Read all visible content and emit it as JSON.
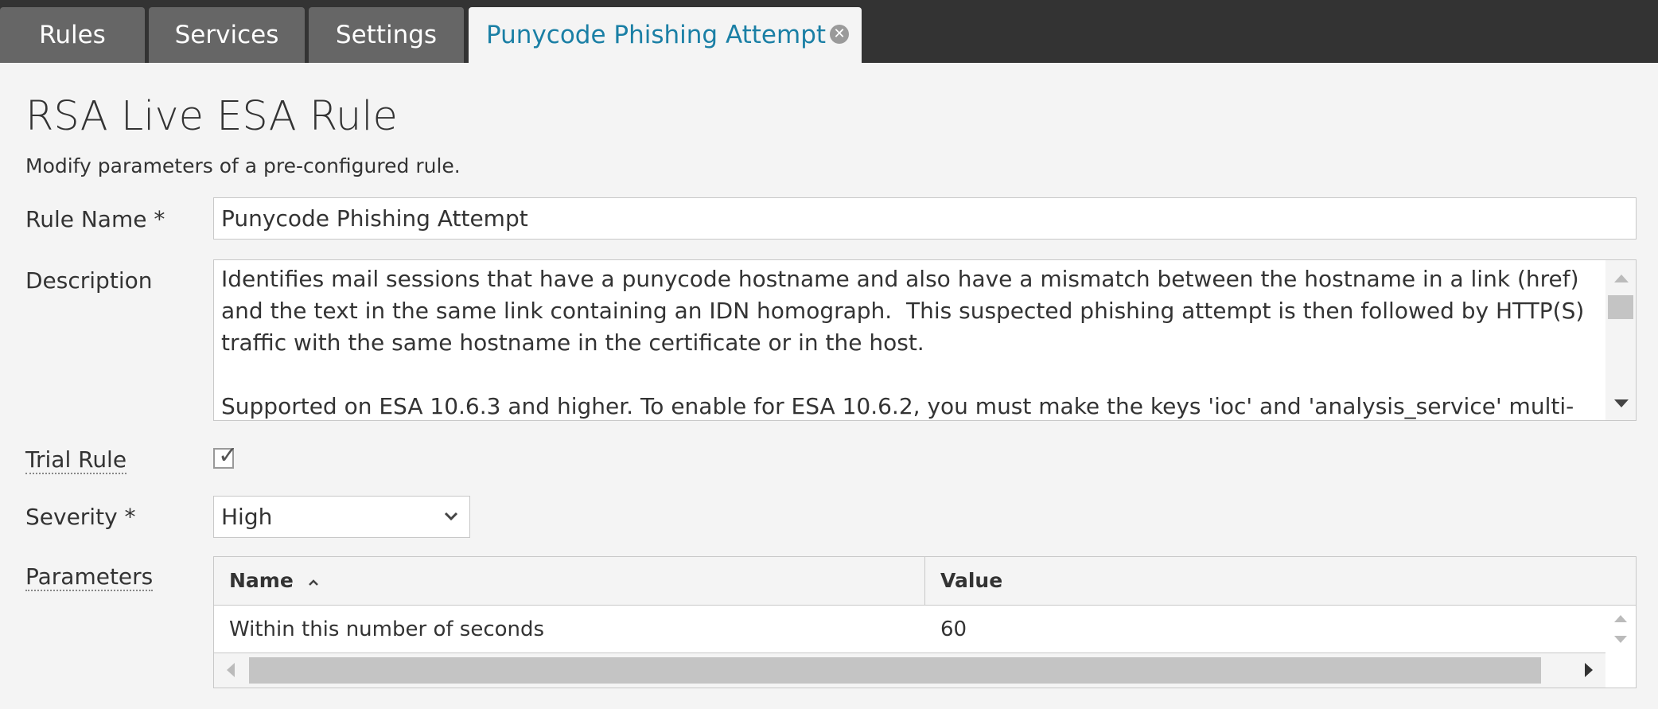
{
  "tabs": [
    {
      "label": "Rules"
    },
    {
      "label": "Services"
    },
    {
      "label": "Settings"
    },
    {
      "label": "Punycode Phishing Attempt",
      "active": true
    }
  ],
  "page": {
    "title": "RSA Live ESA Rule",
    "subtitle": "Modify parameters of a pre-configured rule."
  },
  "form": {
    "rule_name_label": "Rule Name *",
    "rule_name_value": "Punycode Phishing Attempt",
    "description_label": "Description",
    "description_value": "Identifies mail sessions that have a punycode hostname and also have a mismatch between the hostname in a link (href) and the text in the same link containing an IDN homograph.  This suspected phishing attempt is then followed by HTTP(S) traffic with the same hostname in the certificate or in the host.\n\nSupported on ESA 10.6.3 and higher. To enable for ESA 10.6.2, you must make the keys 'ioc' and 'analysis_service' multi-valued",
    "trial_rule_label": "Trial Rule",
    "trial_rule_checked": true,
    "severity_label": "Severity *",
    "severity_value": "High",
    "parameters_label": "Parameters"
  },
  "parameters_table": {
    "columns": [
      "Name",
      "Value"
    ],
    "rows": [
      {
        "name": "Within this number of seconds",
        "value": "60"
      }
    ]
  },
  "icons": {
    "tab_close": "close-circle-icon",
    "checkbox_check": "checkmark-icon",
    "select_chevron": "chevron-down-icon",
    "sort": "sort-ascending-icon"
  },
  "colors": {
    "tabbar_bg": "#333333",
    "tab_inactive_bg": "#666666",
    "tab_active_text": "#1a7fa5",
    "page_bg": "#f4f4f4"
  }
}
